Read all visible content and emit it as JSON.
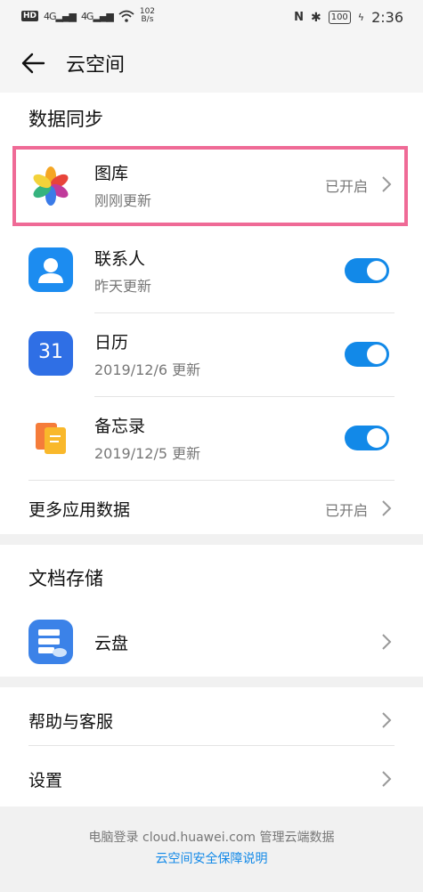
{
  "status_bar": {
    "hd": "HD",
    "net1": "4G",
    "net2": "4G",
    "speed_value": "102",
    "speed_unit": "B/s",
    "battery": "100",
    "time": "2:36"
  },
  "header": {
    "title": "云空间"
  },
  "data_sync": {
    "section_title": "数据同步",
    "gallery": {
      "name": "图库",
      "sub": "刚刚更新",
      "status": "已开启"
    },
    "contacts": {
      "name": "联系人",
      "sub": "昨天更新",
      "toggle_on": true
    },
    "calendar": {
      "name": "日历",
      "sub": "2019/12/6 更新",
      "icon_text": "31",
      "toggle_on": true
    },
    "notes": {
      "name": "备忘录",
      "sub": "2019/12/5 更新",
      "toggle_on": true
    },
    "more": {
      "name": "更多应用数据",
      "status": "已开启"
    }
  },
  "doc_storage": {
    "section_title": "文档存储",
    "drive": {
      "name": "云盘"
    }
  },
  "misc": {
    "help": "帮助与客服",
    "settings": "设置"
  },
  "footer": {
    "line1": "电脑登录 cloud.huawei.com 管理云端数据",
    "link": "云空间安全保障说明"
  },
  "colors": {
    "accent": "#1289e8",
    "highlight": "#ef6a96"
  }
}
